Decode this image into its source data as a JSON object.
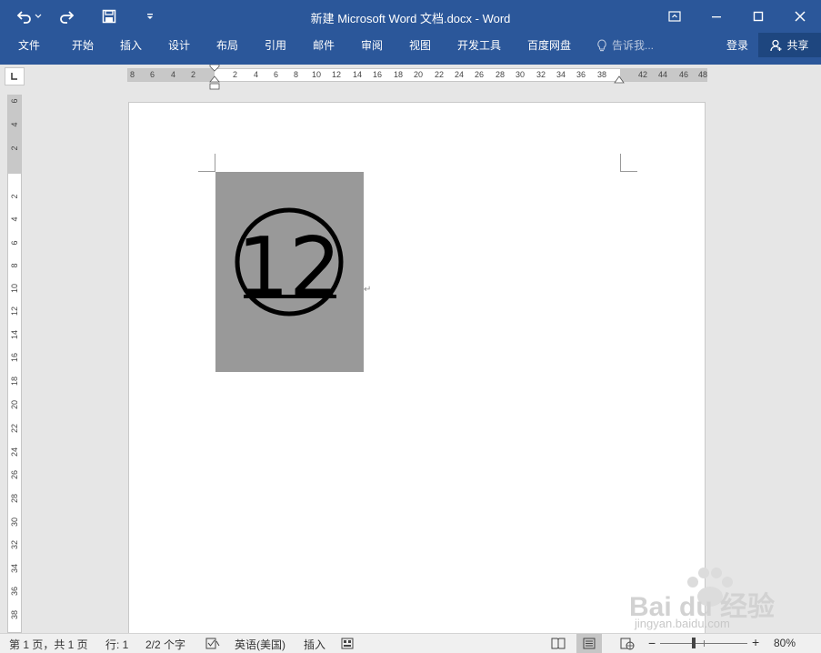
{
  "window": {
    "title": "新建 Microsoft Word 文档.docx - Word"
  },
  "ribbon": {
    "tabs": [
      "文件",
      "开始",
      "插入",
      "设计",
      "布局",
      "引用",
      "邮件",
      "审阅",
      "视图",
      "开发工具",
      "百度网盘"
    ],
    "tell_me": "告诉我...",
    "login": "登录",
    "share": "共享"
  },
  "ruler": {
    "horizontal_left": [
      "8",
      "6",
      "4",
      "2"
    ],
    "horizontal_right": [
      "2",
      "4",
      "6",
      "8",
      "10",
      "12",
      "14",
      "16",
      "18",
      "20",
      "22",
      "24",
      "26",
      "28",
      "30",
      "32",
      "34",
      "36",
      "38"
    ],
    "horizontal_margin": [
      "42",
      "44",
      "46",
      "48"
    ],
    "vertical_top": [
      "6",
      "4",
      "2"
    ],
    "vertical": [
      "2",
      "4",
      "6",
      "8",
      "10",
      "12",
      "14",
      "16",
      "18",
      "20",
      "22",
      "24",
      "26",
      "28",
      "30",
      "32",
      "34",
      "36",
      "38"
    ]
  },
  "document": {
    "circled_number": "12",
    "paragraph_mark": "↵"
  },
  "status": {
    "page": "第 1 页，共 1 页",
    "line": "行: 1",
    "words": "2/2 个字",
    "language": "英语(美国)",
    "mode": "插入",
    "zoom_minus": "−",
    "zoom_plus": "+",
    "zoom": "80%",
    "zoom_level": 0.8
  },
  "watermark": {
    "brand": "Bai du 经验",
    "url": "jingyan.baidu.com"
  },
  "colors": {
    "ribbon": "#2b579a",
    "share_bg": "#1e467f",
    "image_bg": "#999999"
  }
}
